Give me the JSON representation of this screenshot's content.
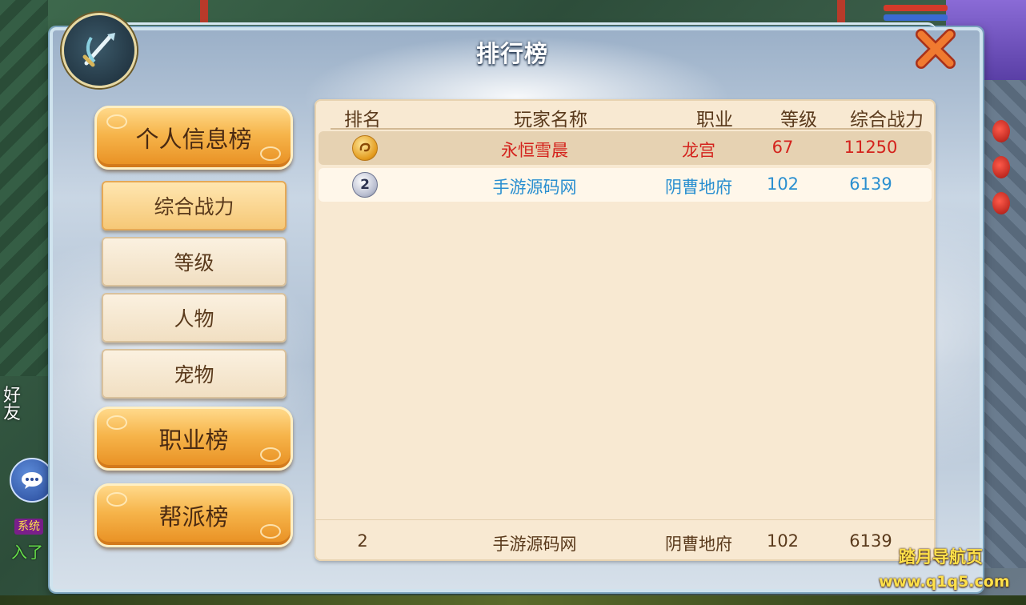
{
  "window": {
    "title": "排行榜"
  },
  "categories": [
    {
      "label": "个人信息榜"
    },
    {
      "label": "职业榜"
    },
    {
      "label": "帮派榜"
    }
  ],
  "personal_subtabs": [
    {
      "label": "综合战力",
      "active": true
    },
    {
      "label": "等级",
      "active": false
    },
    {
      "label": "人物",
      "active": false
    },
    {
      "label": "宠物",
      "active": false
    }
  ],
  "table": {
    "headers": {
      "rank": "排名",
      "name": "玩家名称",
      "job": "职业",
      "level": "等级",
      "power": "综合战力"
    },
    "rows": [
      {
        "rank": 1,
        "rank_icon": "gold-medal-icon",
        "name": "永恒雪晨",
        "job": "龙宫",
        "level": "67",
        "power": "11250",
        "color": "#d4231d"
      },
      {
        "rank": 2,
        "rank_icon": "silver-medal-icon",
        "rank_label": "2",
        "name": "手游源码网",
        "job": "阴曹地府",
        "level": "102",
        "power": "6139",
        "color": "#2a8fd0"
      }
    ],
    "self": {
      "rank": "2",
      "name": "手游源码网",
      "job": "阴曹地府",
      "level": "102",
      "power": "6139"
    }
  },
  "side": {
    "friends_label": "好友",
    "system_badge": "系统",
    "system_text": "入了"
  },
  "watermark": {
    "line1": "踏月导航页",
    "line2": "www.q1q5.com"
  },
  "colors": {
    "accent_orange": "#f6b44a",
    "rank1_red": "#d4231d",
    "rank2_blue": "#2a8fd0",
    "table_bg": "#f8e9d2"
  }
}
